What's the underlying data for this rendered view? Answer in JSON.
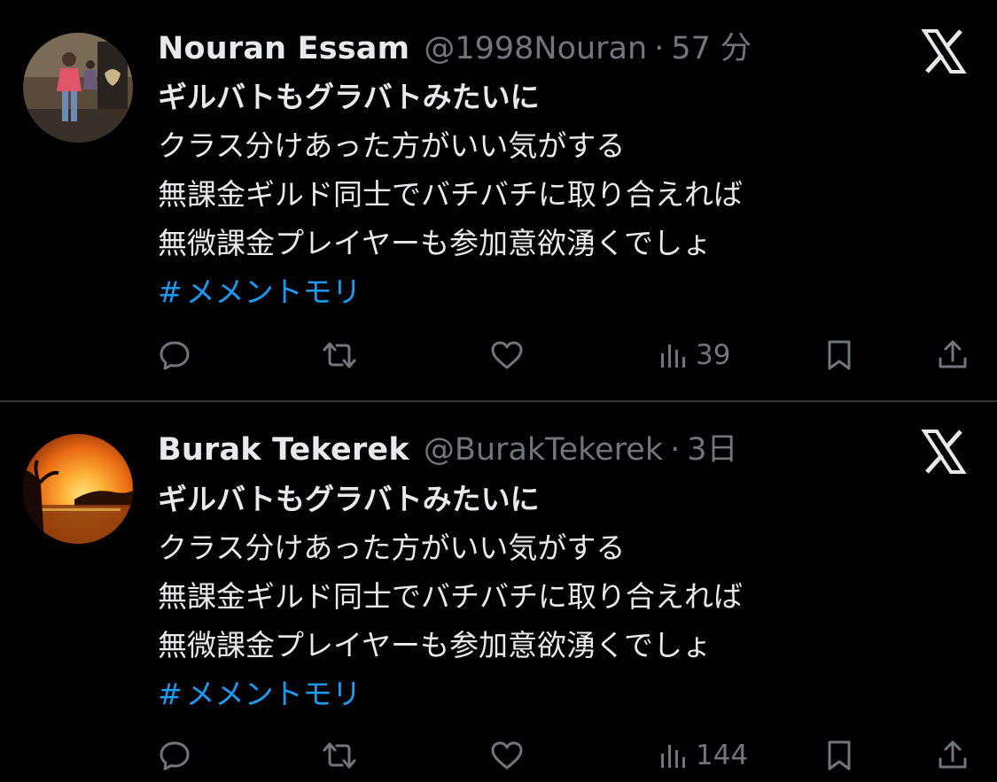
{
  "colors": {
    "background": "#000000",
    "text_primary": "#e7e9ea",
    "text_secondary": "#71767b",
    "hashtag": "#1d9bf0",
    "divider": "#2f3336"
  },
  "icons": {
    "logo": "x-logo-icon",
    "reply": "reply-icon",
    "repost": "repost-icon",
    "like": "heart-icon",
    "views": "views-icon",
    "bookmark": "bookmark-icon",
    "share": "share-icon"
  },
  "tweets": [
    {
      "display_name": "Nouran Essam",
      "handle": "@1998Nouran",
      "separator": "·",
      "time": "57 分",
      "lines": [
        "ギルバトもグラバトみたいに",
        "クラス分けあった方がいい気がする",
        "無課金ギルド同士でバチバチに取り合えれば",
        "無微課金プレイヤーも参加意欲湧くでしょ"
      ],
      "hashtag_sign": "#",
      "hashtag": "メメントモリ",
      "views": "39"
    },
    {
      "display_name": "Burak Tekerek",
      "handle": "@BurakTekerek",
      "separator": "·",
      "time": "3日",
      "lines": [
        "ギルバトもグラバトみたいに",
        "クラス分けあった方がいい気がする",
        "無課金ギルド同士でバチバチに取り合えれば",
        "無微課金プレイヤーも参加意欲湧くでしょ"
      ],
      "hashtag_sign": "#",
      "hashtag": "メメントモリ",
      "views": "144"
    }
  ]
}
